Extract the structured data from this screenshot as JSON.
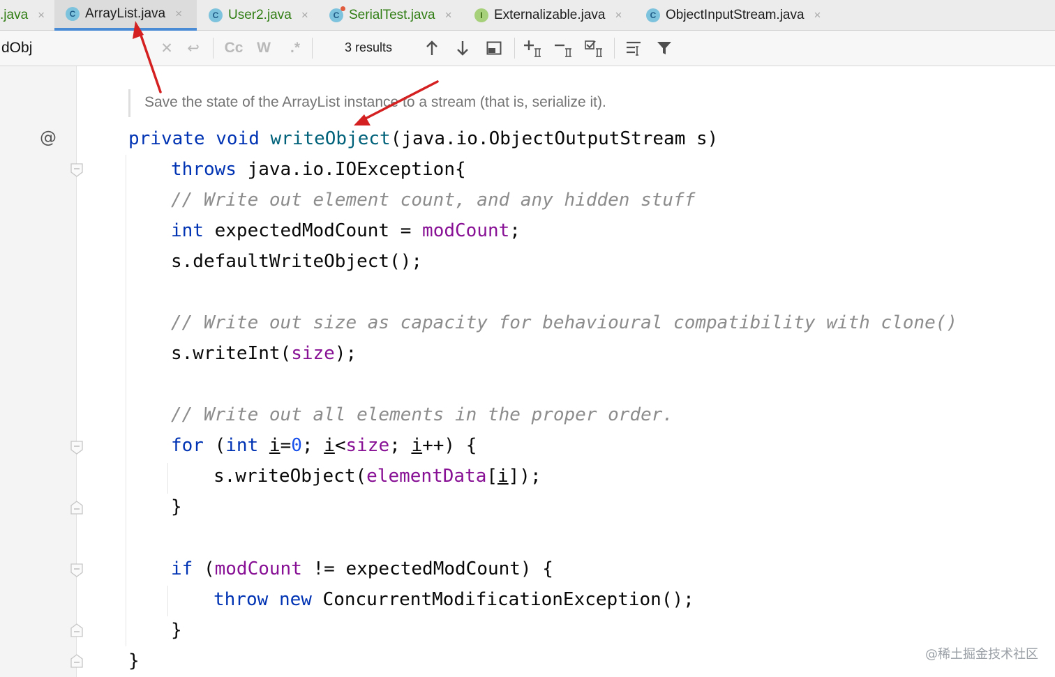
{
  "tabs": [
    {
      "label": ".java",
      "icon": "none",
      "color": "green",
      "active": false
    },
    {
      "label": "ArrayList.java",
      "icon": "class-icon",
      "color": "default",
      "active": true
    },
    {
      "label": "User2.java",
      "icon": "class-icon",
      "color": "green",
      "active": false
    },
    {
      "label": "SerialTest.java",
      "icon": "class-icon",
      "color": "green",
      "active": false
    },
    {
      "label": "Externalizable.java",
      "icon": "interface-icon",
      "color": "default",
      "active": false
    },
    {
      "label": "ObjectInputStream.java",
      "icon": "class-icon",
      "color": "default",
      "active": false
    }
  ],
  "tab_close_glyph": "×",
  "find": {
    "query": "dObj",
    "case_label": "Cc",
    "word_label": "W",
    "regex_label": ".*",
    "results": "3 results"
  },
  "editor": {
    "doc_comment": "Save the state of the ArrayList instance to a stream (that is, serialize it).",
    "gutter_annotation": "@",
    "code": {
      "l1_private": "private",
      "l1_void": "void",
      "l1_method": "writeObject",
      "l1_rest": "(java.io.ObjectOutputStream s)",
      "l2_throws": "throws",
      "l2_rest": " java.io.IOException{",
      "l3_comment": "// Write out element count, and any hidden stuff",
      "l4_int": "int",
      "l4_mid": " expectedModCount = ",
      "l4_field": "modCount",
      "l4_end": ";",
      "l5": "s.defaultWriteObject();",
      "l6_comment": "// Write out size as capacity for behavioural compatibility with clone()",
      "l7_a": "s.writeInt(",
      "l7_field": "size",
      "l7_b": ");",
      "l8_comment": "// Write out all elements in the proper order.",
      "l9_for": "for",
      "l9_open": " (",
      "l9_int": "int",
      "l9_sp": " ",
      "l9_i1": "i",
      "l9_eq": "=",
      "l9_zero": "0",
      "l9_semi": "; ",
      "l9_i2": "i",
      "l9_lt": "<",
      "l9_size": "size",
      "l9_semi2": "; ",
      "l9_i3": "i",
      "l9_end": "++) {",
      "l10_a": "s.writeObject(",
      "l10_field": "elementData",
      "l10_b": "[",
      "l10_i": "i",
      "l10_c": "]);",
      "l11": "}",
      "l12_if": "if",
      "l12_open": " (",
      "l12_field": "modCount",
      "l12_rest": " != expectedModCount) {",
      "l13_throw": "throw",
      "l13_new": "new",
      "l13_rest": " ConcurrentModificationException();",
      "l14": "}",
      "l15": "}"
    }
  },
  "watermark": "@稀土掘金技术社区",
  "colors": {
    "keyword": "#0033b3",
    "method": "#00627a",
    "field": "#871094",
    "number": "#1750eb",
    "comment": "#8c8c8c",
    "annotation_arrow": "#d42020",
    "active_tab_underline": "#4a8bd6"
  }
}
